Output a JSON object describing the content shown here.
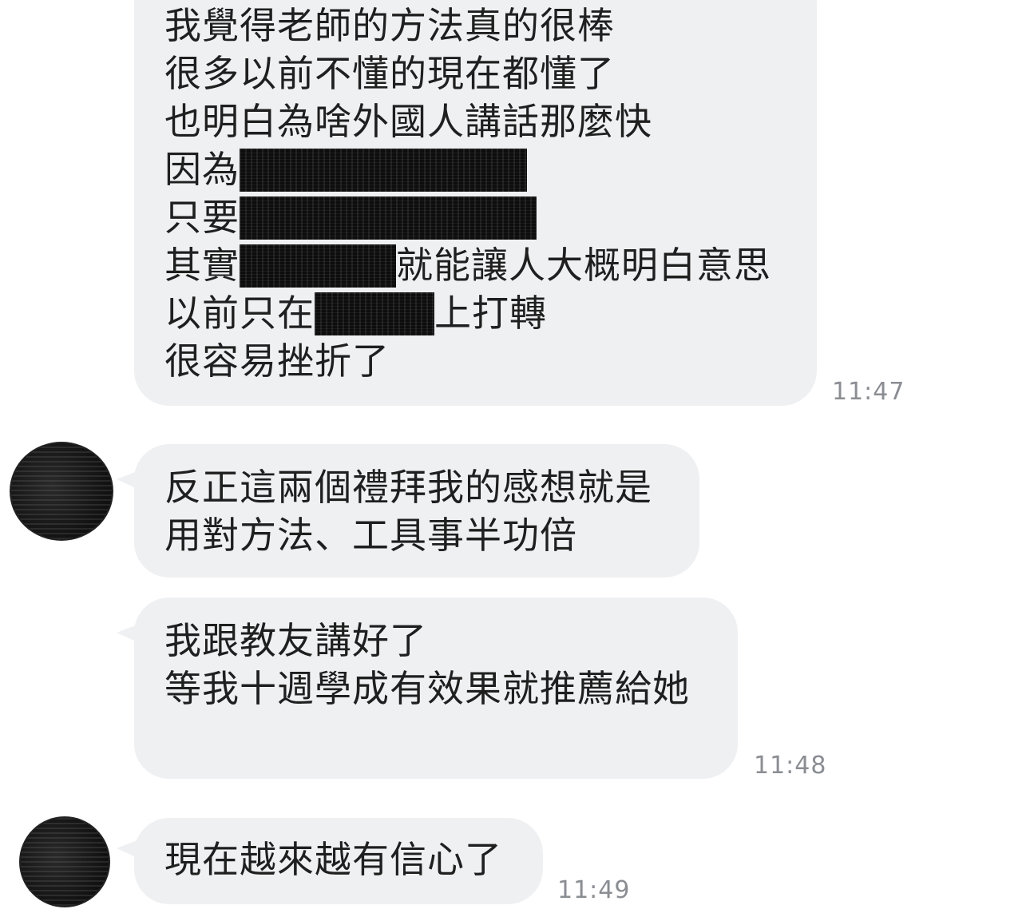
{
  "messages": [
    {
      "lines": [
        {
          "a": "我覺得老師的方法真的很棒"
        },
        {
          "a": "很多以前不懂的現在都懂了"
        },
        {
          "a": "也明白為啥外國人講話那麼快"
        },
        {
          "a": "因為"
        },
        {
          "a": "只要"
        },
        {
          "a": "其實",
          "b": "就能讓人大概明白意思"
        },
        {
          "a": "以前只在",
          "b": "上打轉"
        },
        {
          "a": "很容易挫折了"
        }
      ],
      "time": "11:47"
    },
    {
      "lines": [
        {
          "a": "反正這兩個禮拜我的感想就是"
        },
        {
          "a": "用對方法、工具事半功倍"
        }
      ]
    },
    {
      "lines": [
        {
          "a": "我跟教友講好了"
        },
        {
          "a": "等我十週學成有效果就推薦給她"
        }
      ],
      "time": "11:48"
    },
    {
      "lines": [
        {
          "a": "現在越來越有信心了"
        }
      ],
      "time": "11:49"
    }
  ],
  "colors": {
    "bubble": "#eff0f2",
    "text": "#1f1f1f",
    "timestamp": "#8a8d92"
  }
}
